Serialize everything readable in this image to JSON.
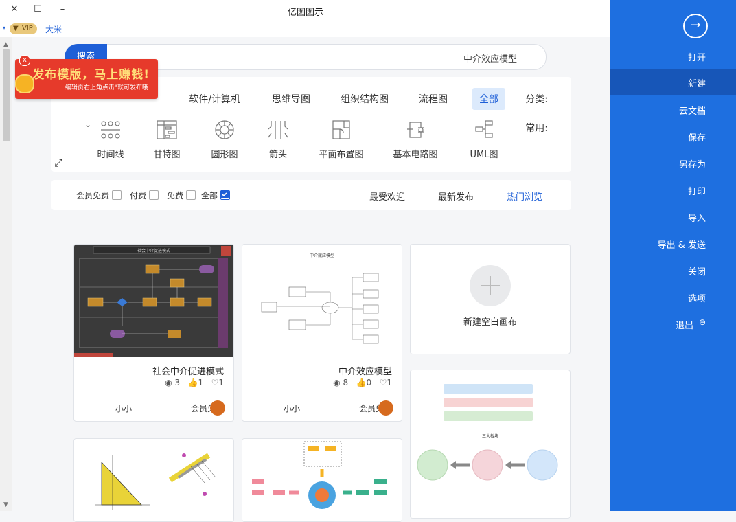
{
  "window": {
    "title": "亿图图示",
    "close": "✕",
    "maximize": "☐",
    "minimize": "–"
  },
  "user": {
    "vip": "VIP",
    "name": "大米"
  },
  "search": {
    "query": "中介效应模型",
    "button": "搜索"
  },
  "ad": {
    "headline": "发布模版，马上赚钱!",
    "subline": "编辑页右上角点击\"就可发布哦",
    "close": "x"
  },
  "categories": {
    "label": "分类:",
    "items": [
      "全部",
      "流程图",
      "组织结构图",
      "思维导图",
      "软件/计算机"
    ],
    "common_label": "常用:",
    "common": [
      {
        "label": "UML图",
        "icon": "uml-icon"
      },
      {
        "label": "基本电路图",
        "icon": "circuit-icon"
      },
      {
        "label": "平面布置图",
        "icon": "floorplan-icon"
      },
      {
        "label": "箭头",
        "icon": "arrow-icon"
      },
      {
        "label": "圆形图",
        "icon": "circle-diagram-icon"
      },
      {
        "label": "甘特图",
        "icon": "gantt-icon"
      },
      {
        "label": "时间线",
        "icon": "timeline-icon"
      }
    ]
  },
  "sort": {
    "hot": "热门浏览",
    "newest": "最新发布",
    "popular": "最受欢迎"
  },
  "filters": {
    "all": "全部",
    "free": "免费",
    "paid": "付费",
    "member_free": "会员免费"
  },
  "new_canvas": {
    "label": "新建空白画布"
  },
  "templates": [
    {
      "title": "中介效应模型",
      "views": "8",
      "likes": "0",
      "favs": "1",
      "author": "小小",
      "price": "会员免费"
    },
    {
      "title": "社会中介促进模式",
      "views": "3",
      "likes": "1",
      "favs": "1",
      "author": "小小",
      "price": "会员免费"
    }
  ],
  "thumb_texts": {
    "mediation_title": "中介效应模型",
    "society_title": "社会中介促进模式",
    "three_major": "三大板块"
  },
  "sidebar": {
    "items": [
      "打开",
      "新建",
      "云文档",
      "保存",
      "另存为",
      "打印",
      "导入",
      "导出 & 发送",
      "关闭",
      "选项",
      "退出"
    ],
    "active": 1
  },
  "colors": {
    "accent": "#1e6fe0",
    "active_menu": "#1756b8",
    "ad_red": "#e63a2b"
  }
}
